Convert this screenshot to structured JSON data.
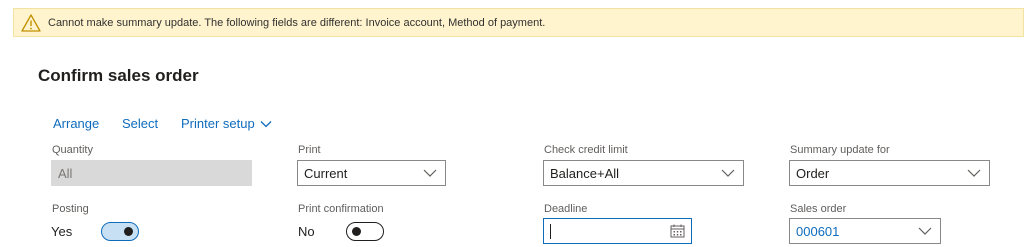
{
  "banner": {
    "message": "Cannot make summary update. The following fields are different: Invoice account, Method of payment."
  },
  "page": {
    "title": "Confirm sales order"
  },
  "toolbar": {
    "arrange": "Arrange",
    "select": "Select",
    "printer_setup": "Printer setup"
  },
  "fields": {
    "quantity": {
      "label": "Quantity",
      "value": "All"
    },
    "print": {
      "label": "Print",
      "value": "Current"
    },
    "check_credit_limit": {
      "label": "Check credit limit",
      "value": "Balance+All"
    },
    "summary_update_for": {
      "label": "Summary update for",
      "value": "Order"
    },
    "posting": {
      "label": "Posting",
      "value": "Yes",
      "on": true
    },
    "print_confirmation": {
      "label": "Print confirmation",
      "value": "No",
      "on": false
    },
    "deadline": {
      "label": "Deadline",
      "value": ""
    },
    "sales_order": {
      "label": "Sales order",
      "value": "000601"
    }
  },
  "icons": {
    "warning": "warning-icon",
    "chevron": "chevron-down-icon",
    "calendar": "calendar-icon"
  },
  "colors": {
    "accent": "#0f6cbd",
    "banner_bg": "#fff4ce",
    "warning": "#d8a200"
  }
}
